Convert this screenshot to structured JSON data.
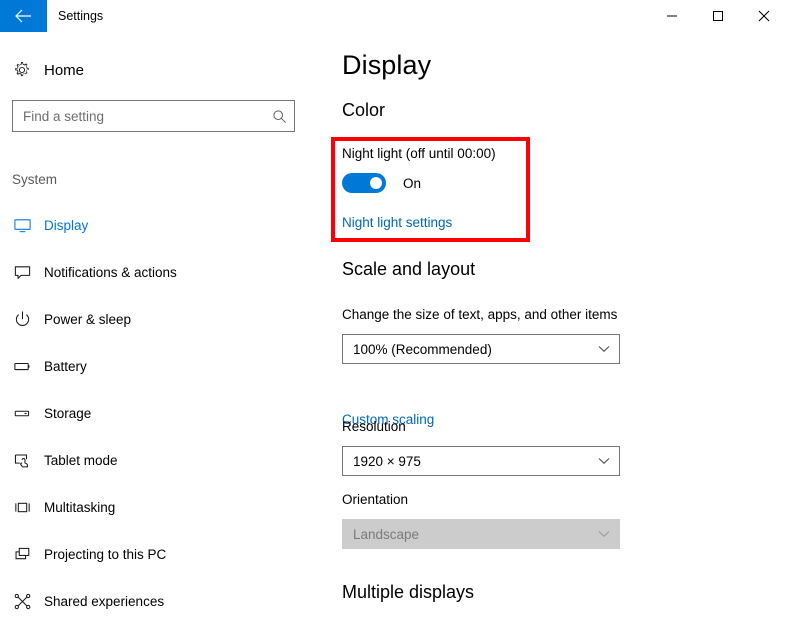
{
  "window": {
    "title": "Settings",
    "back_icon": "back-arrow-icon",
    "controls": {
      "minimize": "minimize-icon",
      "maximize": "maximize-icon",
      "close": "close-icon"
    }
  },
  "sidebar": {
    "home": {
      "label": "Home",
      "icon": "gear-icon"
    },
    "search": {
      "placeholder": "Find a setting",
      "value": "",
      "icon": "search-icon"
    },
    "group_label": "System",
    "items": [
      {
        "label": "Display",
        "icon": "monitor-icon",
        "selected": true
      },
      {
        "label": "Notifications & actions",
        "icon": "speech-bubble-icon",
        "selected": false
      },
      {
        "label": "Power & sleep",
        "icon": "power-icon",
        "selected": false
      },
      {
        "label": "Battery",
        "icon": "battery-icon",
        "selected": false
      },
      {
        "label": "Storage",
        "icon": "storage-drive-icon",
        "selected": false
      },
      {
        "label": "Tablet mode",
        "icon": "tablet-touch-icon",
        "selected": false
      },
      {
        "label": "Multitasking",
        "icon": "multitasking-icon",
        "selected": false
      },
      {
        "label": "Projecting to this PC",
        "icon": "projecting-icon",
        "selected": false
      },
      {
        "label": "Shared experiences",
        "icon": "shared-nodes-icon",
        "selected": false
      }
    ]
  },
  "main": {
    "page_title": "Display",
    "sections": {
      "color": {
        "heading": "Color",
        "nightlight_label": "Night light (off until 00:00)",
        "toggle_state": "On",
        "toggle_on": true,
        "settings_link": "Night light settings",
        "highlight_color": "#fb0006"
      },
      "scale_and_layout": {
        "heading": "Scale and layout",
        "scale_label": "Change the size of text, apps, and other items",
        "scale_value": "100% (Recommended)",
        "custom_scaling_link": "Custom scaling",
        "resolution_label": "Resolution",
        "resolution_value": "1920 × 975",
        "orientation_label": "Orientation",
        "orientation_value": "Landscape",
        "orientation_disabled": true
      },
      "multiple_displays": {
        "heading": "Multiple displays"
      }
    }
  },
  "colors": {
    "accent": "#0078d7",
    "link": "#0067b8",
    "highlight": "#fb0006"
  }
}
